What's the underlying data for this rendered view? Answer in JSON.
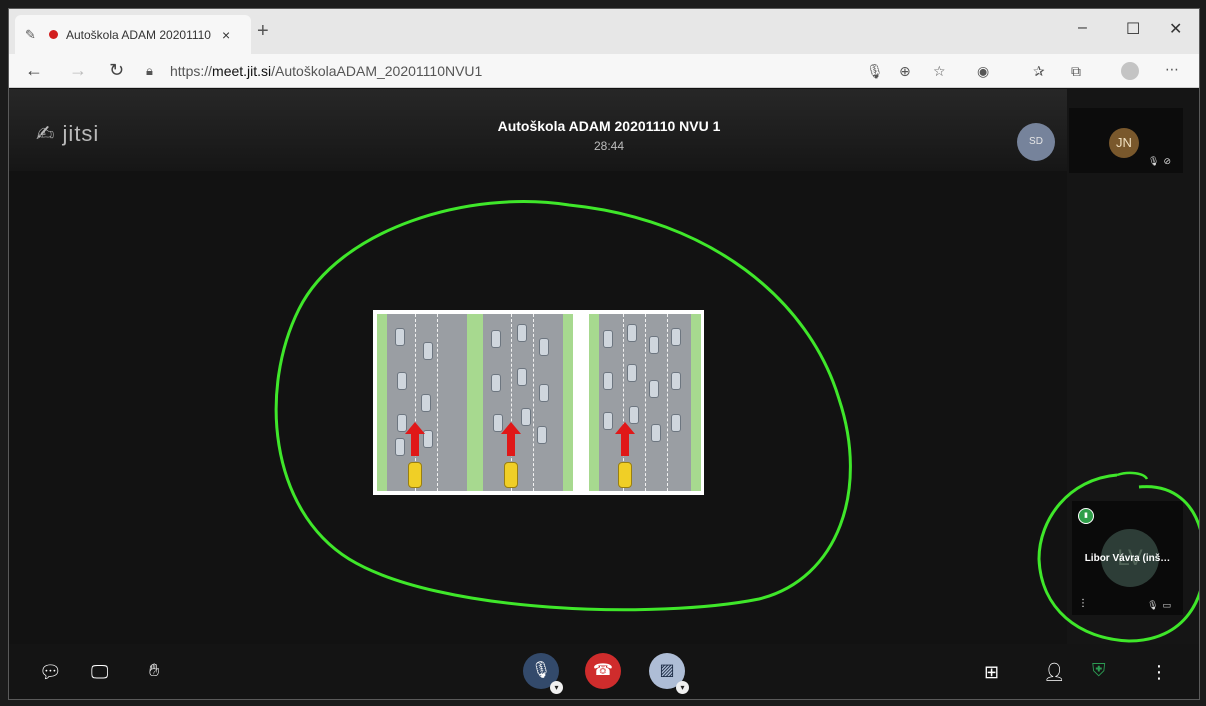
{
  "browser": {
    "tab_title": "Autoškola ADAM 20201110",
    "tab_close": "×",
    "new_tab": "+",
    "url_prefix": "https://",
    "url_domain": "meet.jit.si",
    "url_path": "/AutoškolaADAM_20201110NVU1",
    "window_controls": {
      "minimize": "–",
      "maximize": "☐",
      "close": "✕"
    },
    "nav": {
      "back": "←",
      "forward": "→",
      "refresh": "↻"
    },
    "toolbar_icons": [
      "mic-icon",
      "zoom-icon",
      "favorite-star-icon",
      "extension-icon",
      "favorites-icon",
      "collections-icon",
      "profile-icon",
      "more-icon"
    ]
  },
  "meeting": {
    "logo": "jitsi",
    "title": "Autoškola ADAM 20201110 NVU 1",
    "timer": "28:44"
  },
  "participants": {
    "header_avatar": "SD",
    "thumb1_avatar": "JN",
    "thumb2_name": "Libor Vávra (inš…",
    "thumb2_avatar": "LV"
  },
  "colors": {
    "annotation": "#3fe72a",
    "hangup": "#cf2c2c",
    "mute_button": "#334a6b",
    "video_button": "#aebdd6",
    "shield": "#2b9a52"
  }
}
